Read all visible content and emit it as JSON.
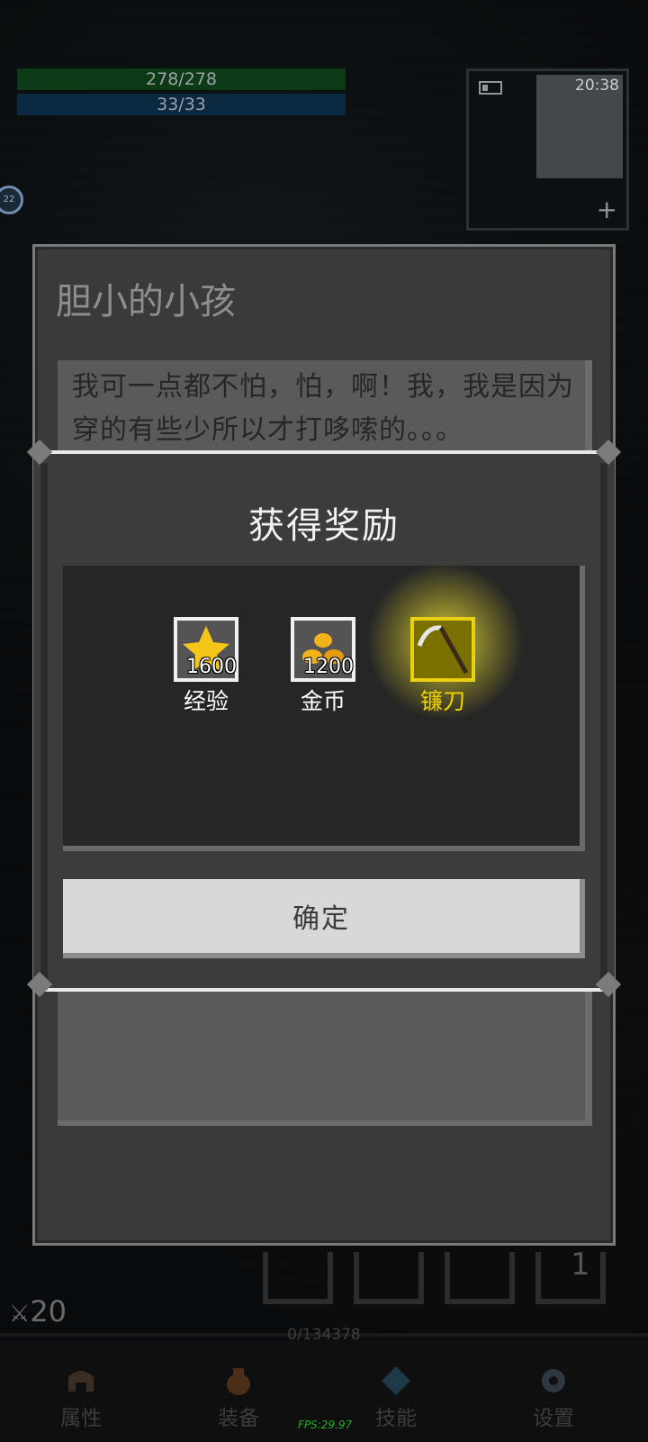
{
  "hud": {
    "hp": "278/278",
    "mp": "33/33",
    "clock": "20:38",
    "side_badge": "22"
  },
  "npc_dialog": {
    "title": "胆小的小孩",
    "text": "我可一点都不怕，怕，啊！我，我是因为穿的有些少所以才打哆嗦的。。。"
  },
  "reward_modal": {
    "title": "获得奖励",
    "items": [
      {
        "name": "经验",
        "qty": "1600",
        "icon": "star-icon"
      },
      {
        "name": "金币",
        "qty": "1200",
        "icon": "gold-coins-icon"
      },
      {
        "name": "镰刀",
        "qty": "",
        "icon": "scythe-icon",
        "highlight": "#e9d010"
      }
    ],
    "confirm_label": "确定"
  },
  "toolbar": {
    "slot_number": "1",
    "weapon_count": "20",
    "exp_text": "0/134378"
  },
  "nav": [
    {
      "label": "属性",
      "icon": "helmet-icon"
    },
    {
      "label": "装备",
      "icon": "bag-icon"
    },
    {
      "label": "技能",
      "icon": "crystal-icon"
    },
    {
      "label": "设置",
      "icon": "gear-icon"
    }
  ],
  "fps": "FPS:29.97"
}
